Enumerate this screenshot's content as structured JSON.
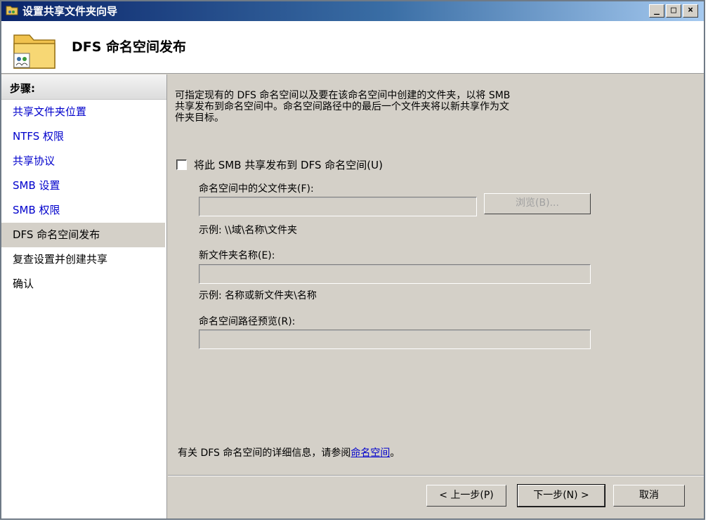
{
  "window": {
    "title": "设置共享文件夹向导",
    "min": "_",
    "max": "□",
    "close": "×"
  },
  "header": {
    "title": "DFS 命名空间发布"
  },
  "steps": {
    "heading": "步骤:",
    "items": [
      {
        "label": "共享文件夹位置",
        "state": "link"
      },
      {
        "label": "NTFS 权限",
        "state": "link"
      },
      {
        "label": "共享协议",
        "state": "link"
      },
      {
        "label": "SMB 设置",
        "state": "link"
      },
      {
        "label": "SMB 权限",
        "state": "link"
      },
      {
        "label": "DFS 命名空间发布",
        "state": "current"
      },
      {
        "label": "复查设置并创建共享",
        "state": "plain"
      },
      {
        "label": "确认",
        "state": "plain"
      }
    ]
  },
  "main": {
    "intro_line1": "可指定现有的 DFS 命名空间以及要在该命名空间中创建的文件夹，以将 SMB",
    "intro_line2": "共享发布到命名空间中。命名空间路径中的最后一个文件夹将以新共享作为文",
    "intro_line3": "件夹目标。",
    "publish_checkbox": {
      "label": "将此 SMB 共享发布到 DFS 命名空间(U)",
      "checked": false
    },
    "parent_folder": {
      "label": "命名空间中的父文件夹(F):",
      "value": "",
      "example": "示例: \\\\域\\名称\\文件夹"
    },
    "browse_button": "浏览(B)...",
    "new_folder": {
      "label": "新文件夹名称(E):",
      "value": "",
      "example": "示例: 名称或新文件夹\\名称"
    },
    "preview": {
      "label": "命名空间路径预览(R):",
      "value": ""
    },
    "info_text": "有关 DFS 命名空间的详细信息，请参阅",
    "info_link": "命名空间",
    "info_end": "。"
  },
  "footer": {
    "back": "< 上一步(P)",
    "next": "下一步(N) >",
    "cancel": "取消"
  }
}
